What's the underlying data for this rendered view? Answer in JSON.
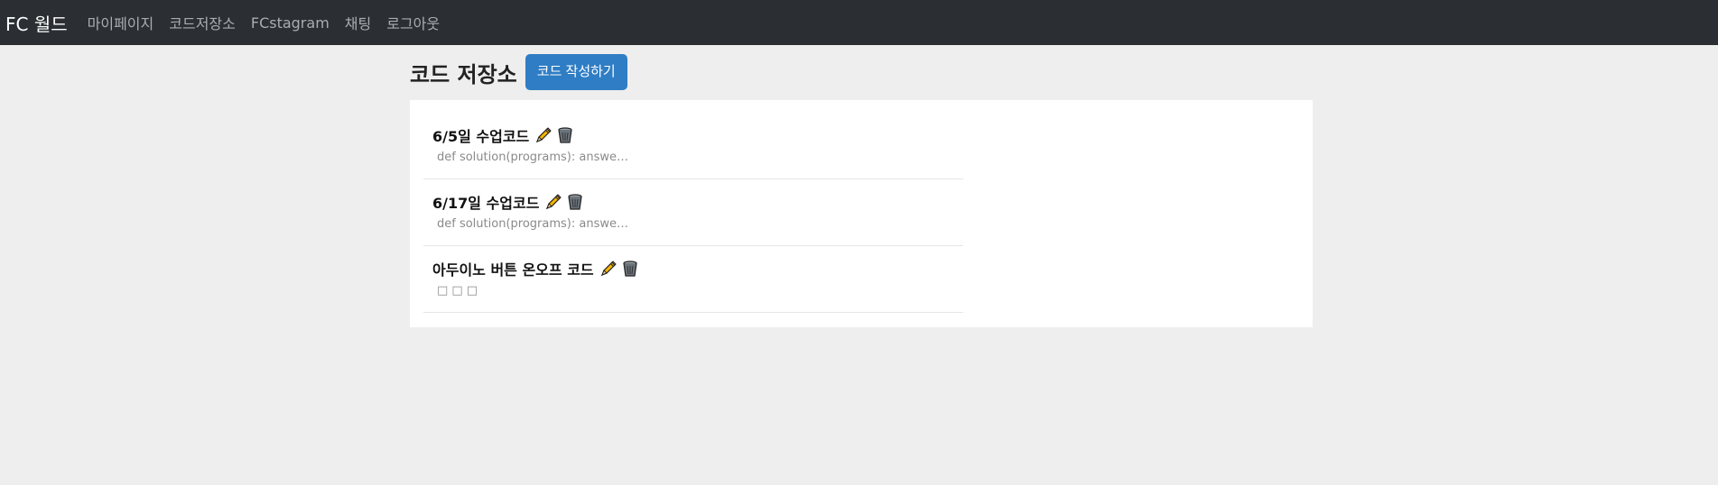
{
  "navbar": {
    "brand": "FC 월드",
    "links": [
      "마이페이지",
      "코드저장소",
      "FCstagram",
      "채팅",
      "로그아웃"
    ]
  },
  "page": {
    "title": "코드 저장소",
    "write_button": "코드 작성하기"
  },
  "codes": [
    {
      "title": "6/5일 수업코드",
      "preview": "def solution(programs): answe…"
    },
    {
      "title": "6/17일 수업코드",
      "preview": "def solution(programs): answe…"
    },
    {
      "title": "아두이노 버튼 온오프 코드",
      "preview": "□ □ □"
    }
  ],
  "icons": {
    "edit": "pencil-icon",
    "delete": "trash-icon"
  }
}
